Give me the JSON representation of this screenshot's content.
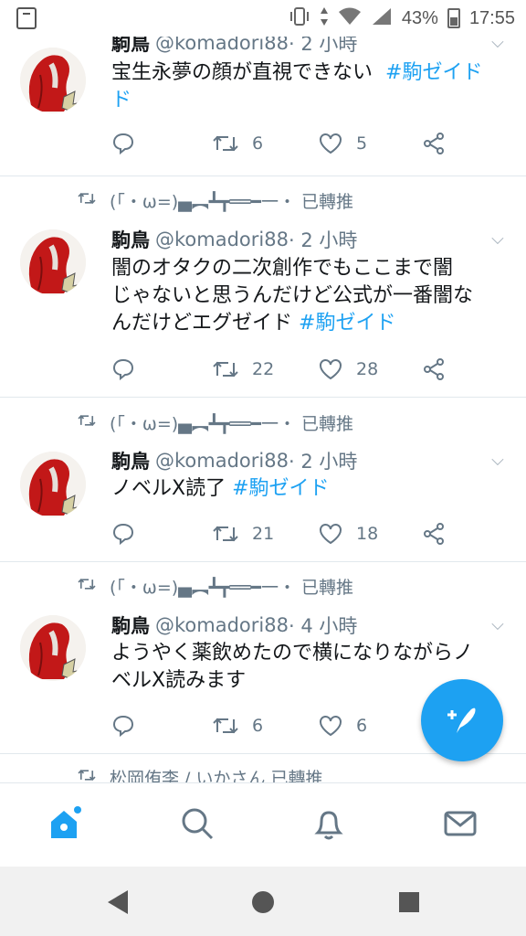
{
  "status_bar": {
    "battery": "43%",
    "time": "17:55"
  },
  "tweets": [
    {
      "retweeter": "",
      "name": "駒鳥",
      "handle": "@komadori88",
      "time": "· 2 小時",
      "text_lines": [
        "宝生永夢の顔が直視できない"
      ],
      "hashtag": "#駒ゼイド",
      "hashtag_wrap": "ド",
      "replies": "",
      "retweets": "6",
      "likes": "5"
    },
    {
      "retweeter": "(「・ω=)▄︻┻┳══━一・ 已轉推",
      "name": "駒鳥",
      "handle": "@komadori88",
      "time": "· 2 小時",
      "text_lines": [
        "闇のオタクの二次創作でもここまで闇",
        "じゃないと思うんだけど公式が一番闇な",
        "んだけどエグゼイド"
      ],
      "hashtag": "#駒ゼイド",
      "replies": "",
      "retweets": "22",
      "likes": "28"
    },
    {
      "retweeter": "(「・ω=)▄︻┻┳══━一・ 已轉推",
      "name": "駒鳥",
      "handle": "@komadori88",
      "time": "· 2 小時",
      "text_lines": [
        "ノベルX読了"
      ],
      "hashtag": "#駒ゼイド",
      "replies": "",
      "retweets": "21",
      "likes": "18"
    },
    {
      "retweeter": "(「・ω=)▄︻┻┳══━一・ 已轉推",
      "name": "駒鳥",
      "handle": "@komadori88",
      "time": "· 4 小時",
      "text_lines": [
        "ようやく薬飲めたので横になりながらノ",
        "ベルX読みます"
      ],
      "hashtag": "",
      "replies": "",
      "retweets": "6",
      "likes": "6"
    }
  ],
  "partial_retweet_line": "松岡侑李 / いかさん 已轉推",
  "icons": {
    "compose": "compose-tweet-icon",
    "tabs": [
      "home-icon",
      "search-icon",
      "notifications-icon",
      "messages-icon"
    ],
    "nav": [
      "back-icon",
      "home-circle-icon",
      "recents-icon"
    ]
  },
  "colors": {
    "accent": "#1da1f2",
    "muted": "#657786",
    "text": "#14171a"
  }
}
